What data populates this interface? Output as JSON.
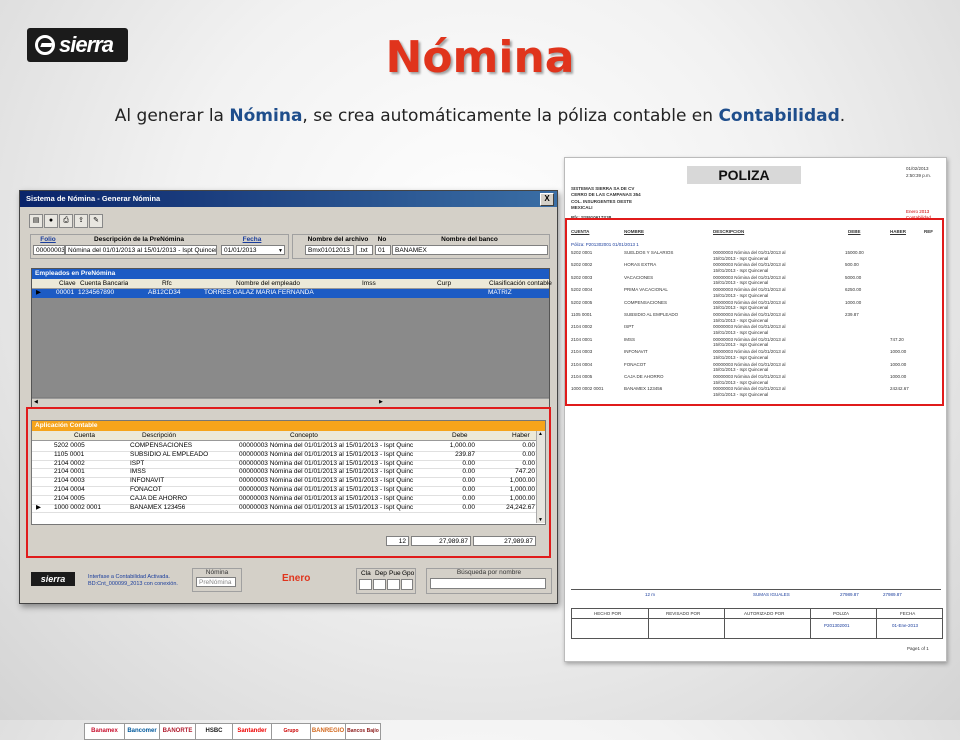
{
  "slide": {
    "title": "Nómina",
    "subtitle_pre": "Al generar la ",
    "subtitle_hl1": "Nómina",
    "subtitle_mid": ", se crea automáticamente la póliza contable en ",
    "subtitle_hl2": "Contabilidad",
    "subtitle_post": ".",
    "logo_text": "sierra"
  },
  "colors": {
    "title": "#e0341c",
    "highlight": "#1f4e8c",
    "accent_blue": "#1c5bc4",
    "accent_orange": "#f6a41b",
    "red_box": "#e01b1b"
  },
  "window": {
    "title": "Sistema de Nómina - Generar Nómina",
    "close": "X",
    "toolbar_icons": [
      "document-icon",
      "record-icon",
      "print-icon",
      "export-icon",
      "edit-icon"
    ],
    "header": {
      "folio_label": "Folio",
      "folio_value": "00000003",
      "desc_label": "Descripción de la PreNómina",
      "desc_value": "Nómina del 01/01/2013 al 15/01/2013 - Ispt Quincenal",
      "fecha_label": "Fecha",
      "fecha_value": "01/01/2013",
      "archivo_label": "Nombre del archivo",
      "archivo_value": "Bmx01012013",
      "archivo_ext": ".txt",
      "no_label": "No",
      "no_value": "01",
      "banco_label": "Nombre del banco",
      "banco_value": "BANAMEX"
    },
    "empleados": {
      "title": "Empleados en PreNómina",
      "columns": [
        "Clave",
        "Cuenta Bancaria",
        "Rfc",
        "Nombre del empleado",
        "Imss",
        "Curp",
        "Clasificación contable"
      ],
      "rows": [
        {
          "clave": "00001",
          "cuenta": "1234567890",
          "rfc": "AB12CD34",
          "nombre": "TORRES GALAZ MARIA FERNANDA",
          "imss": "",
          "curp": "",
          "clasif": "MATRIZ"
        }
      ]
    },
    "aplicacion": {
      "title": "Aplicación Contable",
      "columns": [
        "Cuenta",
        "Descripción",
        "Concepto",
        "Debe",
        "Haber"
      ],
      "rows": [
        {
          "cuenta": "5202 0005",
          "desc": "COMPENSACIONES",
          "concepto": "00000003 Nómina del 01/01/2013 al 15/01/2013 - Ispt Quinc",
          "debe": "1,000.00",
          "haber": "0.00"
        },
        {
          "cuenta": "1105 0001",
          "desc": "SUBSIDIO AL EMPLEADO",
          "concepto": "00000003 Nómina del 01/01/2013 al 15/01/2013 - Ispt Quinc",
          "debe": "239.87",
          "haber": "0.00"
        },
        {
          "cuenta": "2104 0002",
          "desc": "ISPT",
          "concepto": "00000003 Nómina del 01/01/2013 al 15/01/2013 - Ispt Quinc",
          "debe": "0.00",
          "haber": "0.00"
        },
        {
          "cuenta": "2104 0001",
          "desc": "IMSS",
          "concepto": "00000003 Nómina del 01/01/2013 al 15/01/2013 - Ispt Quinc",
          "debe": "0.00",
          "haber": "747.20"
        },
        {
          "cuenta": "2104 0003",
          "desc": "INFONAVIT",
          "concepto": "00000003 Nómina del 01/01/2013 al 15/01/2013 - Ispt Quinc",
          "debe": "0.00",
          "haber": "1,000.00"
        },
        {
          "cuenta": "2104 0004",
          "desc": "FONACOT",
          "concepto": "00000003 Nómina del 01/01/2013 al 15/01/2013 - Ispt Quinc",
          "debe": "0.00",
          "haber": "1,000.00"
        },
        {
          "cuenta": "2104 0005",
          "desc": "CAJA DE AHORRO",
          "concepto": "00000003 Nómina del 01/01/2013 al 15/01/2013 - Ispt Quinc",
          "debe": "0.00",
          "haber": "1,000.00"
        },
        {
          "cuenta": "1000 0002 0001",
          "desc": "BANAMEX 123456",
          "concepto": "00000003 Nómina del 01/01/2013 al 15/01/2013 - Ispt Quinc",
          "debe": "0.00",
          "haber": "24,242.67"
        }
      ],
      "count": "12",
      "total_debe": "27,989.87",
      "total_haber": "27,989.87",
      "banks": [
        "Banamex",
        "Bancomer",
        "BANORTE",
        "HSBC",
        "Santander",
        "Grupo Scotiabank",
        "BANREGIO",
        "Bancos Bajío"
      ]
    },
    "footer": {
      "logo_text": "sierra",
      "status_line1": "Interfase a Contabilidad Activada.",
      "status_line2": "BD:Cnt_000099_2013 con conexión.",
      "nomina_label": "Nómina",
      "nomina_value": "PreNómina",
      "month": "Enero",
      "cols": [
        "Cla",
        "Dep",
        "Pue",
        "Gpo"
      ],
      "search_label": "Búsqueda por nombre",
      "search_value": ""
    }
  },
  "poliza": {
    "title": "POLIZA",
    "date": "01/02/2013",
    "time": "2:50:39 p.m.",
    "company": [
      "SISTEMAS SIERRA SA DE CV",
      "CERRO DE LAS CAMPANAS 354",
      "COL. INSURGENTES OESTE",
      "MEXICALI"
    ],
    "rfc": "Rfc: SSI910617S38",
    "period": "Enero 2013",
    "type": "Contabilidad",
    "columns": [
      "CUENTA",
      "NOMBRE",
      "DESCRIPCION",
      "DEBE",
      "HABER",
      "REF"
    ],
    "poliza_line": "Póliza:  P201302001       01/01/2013  1",
    "rows": [
      {
        "cuenta": "5202 0001",
        "nombre": "SUELDOS Y SALARIOS",
        "d1": "00000003 Nómina del 01/01/2013 al",
        "d2": "15/01/2013 - Ispt Quincenal",
        "debe": "15000.00",
        "haber": ""
      },
      {
        "cuenta": "5202 0002",
        "nombre": "HORAS EXTRA",
        "d1": "00000003 Nómina del 01/01/2013 al",
        "d2": "15/01/2013 - Ispt Quincenal",
        "debe": "500.00",
        "haber": ""
      },
      {
        "cuenta": "5202 0003",
        "nombre": "VACACIONES",
        "d1": "00000003 Nómina del 01/01/2013 al",
        "d2": "15/01/2013 - Ispt Quincenal",
        "debe": "5000.00",
        "haber": ""
      },
      {
        "cuenta": "5202 0004",
        "nombre": "PRIMA VACACIONAL",
        "d1": "00000003 Nómina del 01/01/2013 al",
        "d2": "15/01/2013 - Ispt Quincenal",
        "debe": "6250.00",
        "haber": ""
      },
      {
        "cuenta": "5202 0005",
        "nombre": "COMPENSACIONES",
        "d1": "00000003 Nómina del 01/01/2013 al",
        "d2": "15/01/2013 - Ispt Quincenal",
        "debe": "1000.00",
        "haber": ""
      },
      {
        "cuenta": "1105 0001",
        "nombre": "SUBSIDIO AL EMPLEADO",
        "d1": "00000003 Nómina del 01/01/2013 al",
        "d2": "15/01/2013 - Ispt Quincenal",
        "debe": "239.87",
        "haber": ""
      },
      {
        "cuenta": "2104 0002",
        "nombre": "ISPT",
        "d1": "00000003 Nómina del 01/01/2013 al",
        "d2": "15/01/2013 - Ispt Quincenal",
        "debe": "",
        "haber": ""
      },
      {
        "cuenta": "2104 0001",
        "nombre": "IMSS",
        "d1": "00000003 Nómina del 01/01/2013 al",
        "d2": "15/01/2013 - Ispt Quincenal",
        "debe": "",
        "haber": "747.20"
      },
      {
        "cuenta": "2104 0003",
        "nombre": "INFONAVIT",
        "d1": "00000003 Nómina del 01/01/2013 al",
        "d2": "15/01/2013 - Ispt Quincenal",
        "debe": "",
        "haber": "1000.00"
      },
      {
        "cuenta": "2104 0004",
        "nombre": "FONACOT",
        "d1": "00000003 Nómina del 01/01/2013 al",
        "d2": "15/01/2013 - Ispt Quincenal",
        "debe": "",
        "haber": "1000.00"
      },
      {
        "cuenta": "2104 0005",
        "nombre": "CAJA DE AHORRO",
        "d1": "00000003 Nómina del 01/01/2013 al",
        "d2": "15/01/2013 - Ispt Quincenal",
        "debe": "",
        "haber": "1000.00"
      },
      {
        "cuenta": "1000 0002 0001",
        "nombre": "BANAMEX 123456",
        "d1": "00000003 Nómina del 01/01/2013 al",
        "d2": "15/01/2013 - Ispt Quincenal",
        "debe": "",
        "haber": "24242.67"
      }
    ],
    "totals": {
      "count": "12 m",
      "label": "SUMAS IGUALES",
      "debe": "27989.87",
      "haber": "27989.87"
    },
    "sign_headers": [
      "HECHO POR",
      "REVISADO POR",
      "AUTORIZADO POR",
      "POLIZA",
      "FECHA"
    ],
    "sign_values": [
      "",
      "",
      "",
      "P201302001",
      "01-Ene-2013"
    ],
    "page": "Page1 of 1"
  }
}
